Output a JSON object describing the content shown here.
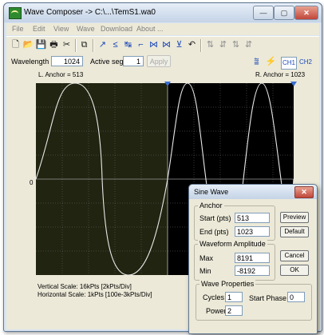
{
  "window": {
    "title": "Wave Composer -> C:\\...\\TemS1.wa0",
    "min_glyph": "—",
    "max_glyph": "▢",
    "close_glyph": "✕"
  },
  "menu": {
    "items": [
      {
        "name": "file",
        "label": "File"
      },
      {
        "name": "edit",
        "label": "Edit"
      },
      {
        "name": "view",
        "label": "View"
      },
      {
        "name": "wave",
        "label": "Wave"
      },
      {
        "name": "download",
        "label": "Download"
      },
      {
        "name": "about",
        "label": "About ..."
      }
    ]
  },
  "toolbar": {
    "icons": [
      "new-file-icon",
      "open-folder-icon",
      "save-icon",
      "print-icon",
      "cut-icon",
      "copy-icon",
      "paste-icon",
      "wave-tool-1-icon",
      "wave-tool-2-icon",
      "wave-tool-3-icon",
      "wave-tool-4-icon",
      "wave-tool-5-icon",
      "wave-tool-6-icon",
      "wave-tool-7-icon",
      "undo-icon",
      "disabled-tool-1-icon",
      "disabled-tool-2-icon",
      "disabled-tool-3-icon",
      "disabled-tool-4-icon",
      "download-waveform-icon",
      "lightning-icon"
    ]
  },
  "controls": {
    "wavelength_label": "Wavelength",
    "wavelength_value": "1024",
    "active_seg_label": "Active seg",
    "active_seg_value": "1",
    "apply_label": "Apply",
    "ch1_label": "CH1",
    "ch2_label": "CH2"
  },
  "anchors": {
    "left_label": "L. Anchor = 513",
    "right_label": "R. Anchor = 1023"
  },
  "plot": {
    "zero_label": "0",
    "colors": {
      "grid": "#7a7a7a",
      "highlight_bg": "#202410",
      "background": "#000000",
      "trace": "#e8e8e8",
      "marker": "#3a6fd0"
    }
  },
  "status": {
    "vertical": "Vertical Scale: 16kPts  [2kPts/Div]",
    "horizontal": "Horizontal Scale: 1kPts [100e-3kPts/Div]"
  },
  "dialog": {
    "title": "Sine Wave",
    "close_glyph": "✕",
    "anchor_group": "Anchor",
    "start_label": "Start (pts)",
    "start_value": "513",
    "end_label": "End  (pts)",
    "end_value": "1023",
    "amplitude_group": "Waveform Amplitude",
    "max_label": "Max",
    "max_value": "8191",
    "min_label": "Min",
    "min_value": "-8192",
    "properties_group": "Wave Properties",
    "cycles_label": "Cycles",
    "cycles_value": "1",
    "start_phase_label": "Start Phase",
    "start_phase_value": "0",
    "power_label": "Power",
    "power_value": "2",
    "preview_label": "Preview",
    "default_label": "Default",
    "cancel_label": "Cancel",
    "ok_label": "OK"
  }
}
